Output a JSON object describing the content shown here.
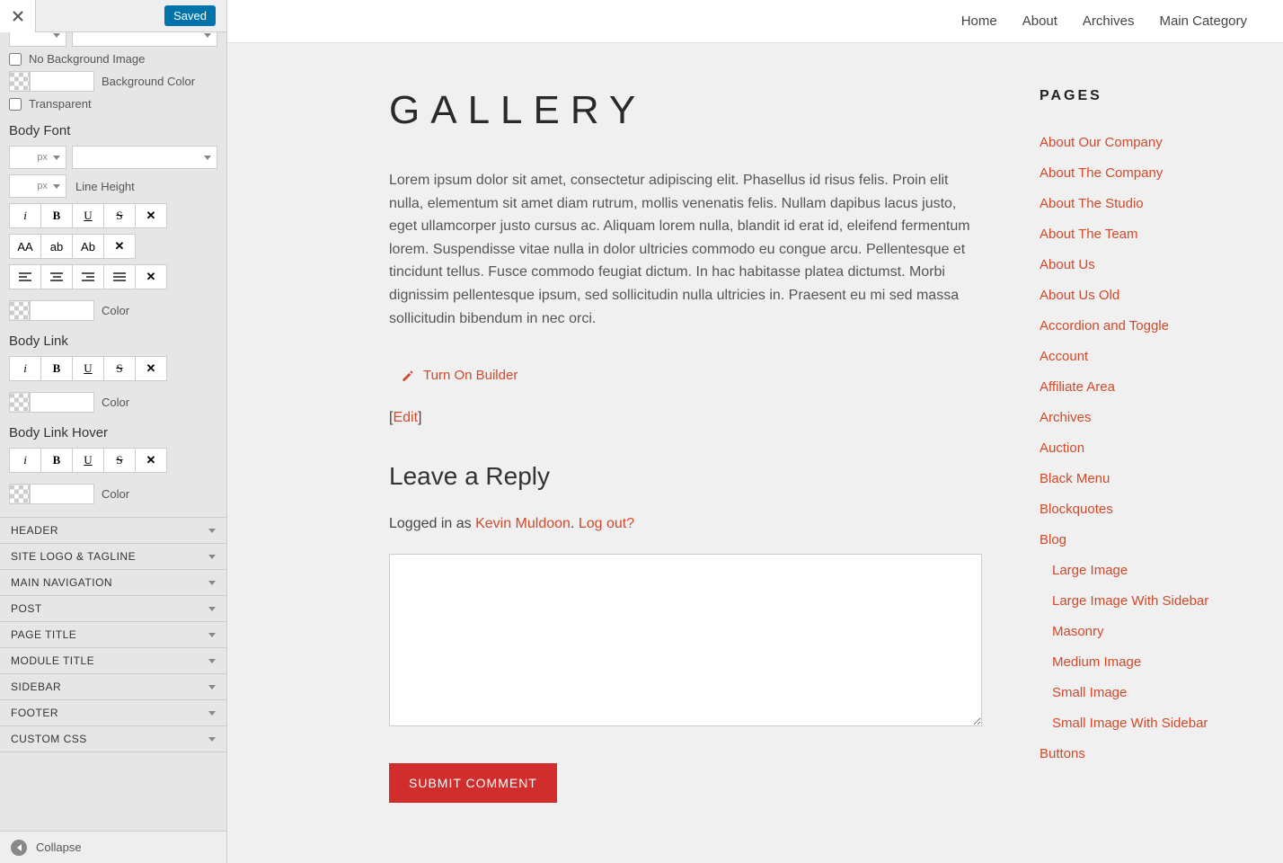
{
  "panel": {
    "saved_label": "Saved",
    "no_bg_label": "No Background Image",
    "bg_color_label": "Background Color",
    "transparent_label": "Transparent",
    "body_font_label": "Body Font",
    "line_height_label": "Line Height",
    "px_unit": "px",
    "color_label": "Color",
    "body_link_label": "Body Link",
    "body_link_hover_label": "Body Link Hover",
    "text_aa": "AA",
    "text_ab_lower": "ab",
    "text_ab_cap": "Ab",
    "accordion": [
      "HEADER",
      "SITE LOGO & TAGLINE",
      "MAIN NAVIGATION",
      "POST",
      "PAGE TITLE",
      "MODULE TITLE",
      "SIDEBAR",
      "FOOTER",
      "CUSTOM CSS"
    ],
    "collapse_label": "Collapse"
  },
  "nav": [
    "Home",
    "About",
    "Archives",
    "Main Category"
  ],
  "page": {
    "title": "GALLERY",
    "body": "Lorem ipsum dolor sit amet, consectetur adipiscing elit. Phasellus id risus felis. Proin elit nulla, elementum sit amet diam rutrum, mollis venenatis felis. Nullam dapibus lacus justo, eget ullamcorper justo cursus ac. Aliquam lorem nulla, blandit id erat id, eleifend fermentum lorem. Suspendisse vitae nulla in dolor ultricies commodo eu congue arcu. Pellentesque et tincidunt tellus. Fusce commodo feugiat dictum. In hac habitasse platea dictumst. Morbi dignissim pellentesque ipsum, sed sollicitudin nulla ultricies in. Praesent eu mi sed massa sollicitudin bibendum in nec orci.",
    "builder_label": "Turn On Builder",
    "edit_label": "Edit",
    "reply_title": "Leave a Reply",
    "logged_in_prefix": "Logged in as ",
    "user_name": "Kevin Muldoon",
    "logout_label": "Log out?",
    "submit_label": "SUBMIT COMMENT"
  },
  "sidebar": {
    "title": "PAGES",
    "items": [
      {
        "label": "About Our Company",
        "indent": false
      },
      {
        "label": "About The Company",
        "indent": false
      },
      {
        "label": "About The Studio",
        "indent": false
      },
      {
        "label": "About The Team",
        "indent": false
      },
      {
        "label": "About Us",
        "indent": false
      },
      {
        "label": "About Us Old",
        "indent": false
      },
      {
        "label": "Accordion and Toggle",
        "indent": false
      },
      {
        "label": "Account",
        "indent": false
      },
      {
        "label": "Affiliate Area",
        "indent": false
      },
      {
        "label": "Archives",
        "indent": false
      },
      {
        "label": "Auction",
        "indent": false
      },
      {
        "label": "Black Menu",
        "indent": false
      },
      {
        "label": "Blockquotes",
        "indent": false
      },
      {
        "label": "Blog",
        "indent": false
      },
      {
        "label": "Large Image",
        "indent": true
      },
      {
        "label": "Large Image With Sidebar",
        "indent": true
      },
      {
        "label": "Masonry",
        "indent": true
      },
      {
        "label": "Medium Image",
        "indent": true
      },
      {
        "label": "Small Image",
        "indent": true
      },
      {
        "label": "Small Image With Sidebar",
        "indent": true
      },
      {
        "label": "Buttons",
        "indent": false
      }
    ]
  }
}
